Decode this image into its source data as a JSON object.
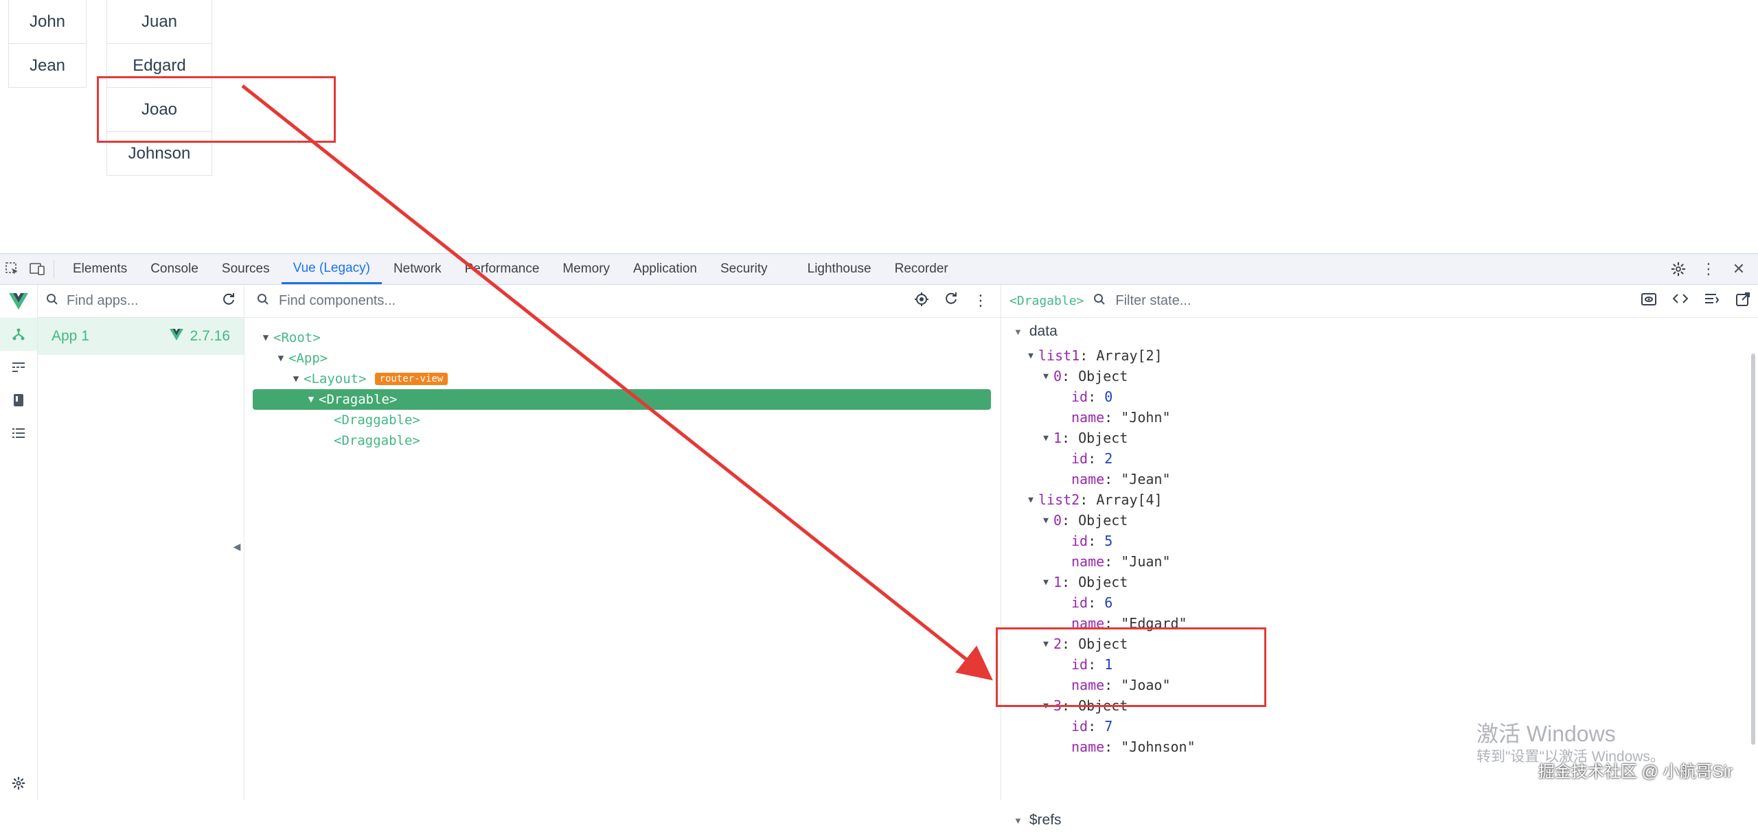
{
  "page": {
    "list1": [
      "John",
      "Jean"
    ],
    "list2": [
      "Juan",
      "Edgard",
      "Joao",
      "Johnson"
    ]
  },
  "devtools": {
    "tabs": [
      "Elements",
      "Console",
      "Sources",
      "Vue (Legacy)",
      "Network",
      "Performance",
      "Memory",
      "Application",
      "Security",
      "Lighthouse",
      "Recorder"
    ],
    "active_tab": "Vue (Legacy)"
  },
  "vue": {
    "apps_search_placeholder": "Find apps...",
    "app_name": "App 1",
    "app_version": "2.7.16",
    "components_search_placeholder": "Find components...",
    "tree": {
      "root": "<Root>",
      "app": "<App>",
      "layout": "<Layout>",
      "layout_badge": "router-view",
      "dragable": "<Dragable>",
      "draggable_1": "<Draggable>",
      "draggable_2": "<Draggable>"
    },
    "selected_component": "<Dragable>",
    "state_filter_placeholder": "Filter state...",
    "state_section": "data",
    "refs_section": "$refs",
    "state": {
      "list1_key": "list1",
      "list1_type": "Array[2]",
      "list2_key": "list2",
      "list2_type": "Array[4]",
      "object_type": "Object",
      "id_key": "id",
      "name_key": "name",
      "list1": [
        {
          "index": "0",
          "id": "0",
          "name": "\"John\""
        },
        {
          "index": "1",
          "id": "2",
          "name": "\"Jean\""
        }
      ],
      "list2": [
        {
          "index": "0",
          "id": "5",
          "name": "\"Juan\""
        },
        {
          "index": "1",
          "id": "6",
          "name": "\"Edgard\""
        },
        {
          "index": "2",
          "id": "1",
          "name": "\"Joao\""
        },
        {
          "index": "3",
          "id": "7",
          "name": "\"Johnson\""
        }
      ]
    }
  },
  "watermark": {
    "activate_title": "激活 Windows",
    "activate_sub": "转到\"设置\"以激活 Windows。",
    "credit": "掘金技术社区 @ 小航哥Sir"
  },
  "colors": {
    "vue_green": "#42b883",
    "selected_row": "#42a870",
    "annotation_red": "#e53935",
    "active_tab_blue": "#1a73e8",
    "badge_orange": "#f2841f"
  },
  "icons": [
    "inspect-element-icon",
    "device-toolbar-icon",
    "settings-gear-icon",
    "more-vert-icon",
    "close-icon",
    "vue-logo-icon",
    "components-tree-icon",
    "timeline-icon",
    "vuex-icon",
    "events-icon",
    "refresh-icon",
    "search-icon",
    "target-icon",
    "export-icon",
    "code-icon",
    "wrap-icon",
    "open-in-editor-icon"
  ]
}
